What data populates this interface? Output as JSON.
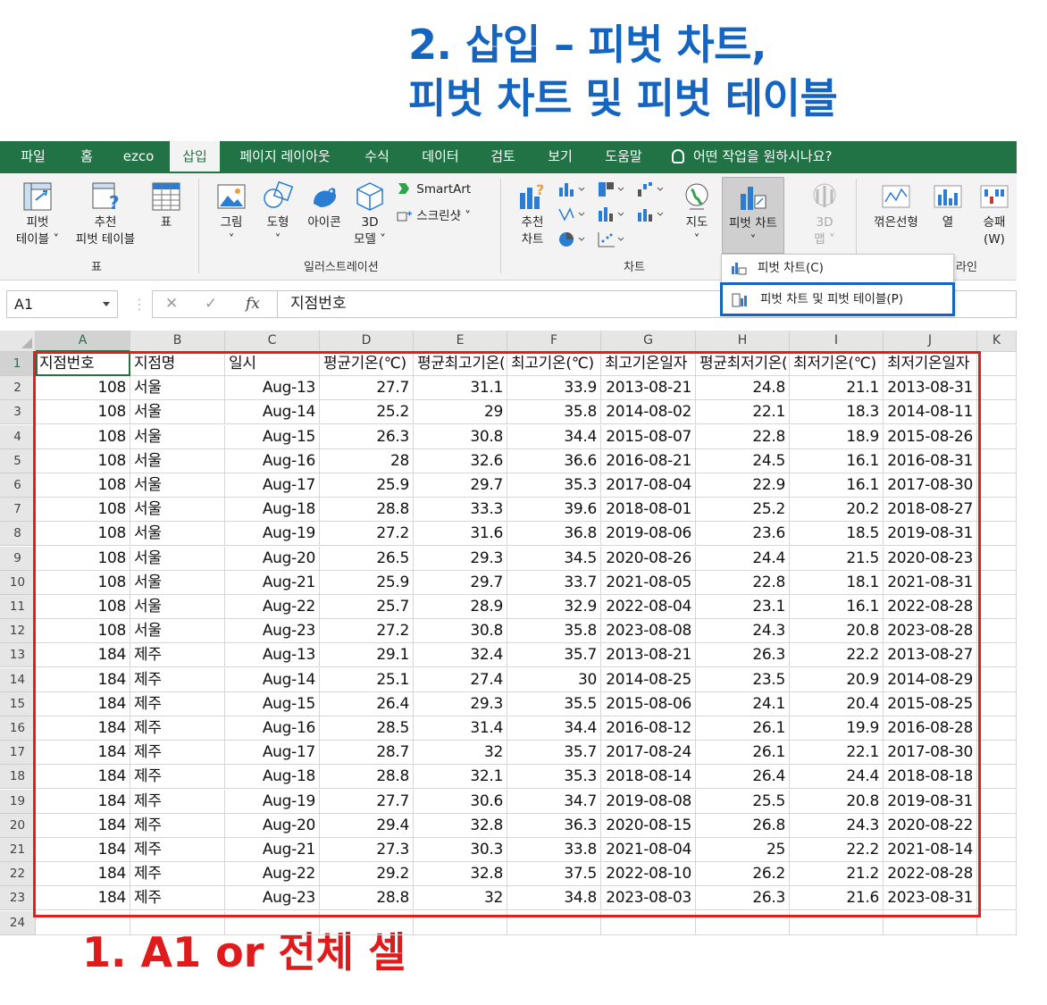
{
  "captions": {
    "top_line1": "2. 삽입 – 피벗 차트,",
    "top_line2": "피벗 차트 및 피벗 테이블",
    "bottom": "1. A1 or 전체 셀"
  },
  "colors": {
    "excel_green": "#217346",
    "caption_blue": "#1565c0",
    "caption_red": "#e01b1b"
  },
  "menu": {
    "tabs": [
      "파일",
      "홈",
      "ezco",
      "삽입",
      "페이지 레이아웃",
      "수식",
      "데이터",
      "검토",
      "보기",
      "도움말"
    ],
    "active_tab": "삽입",
    "tell_me": "어떤 작업을 원하시나요?"
  },
  "ribbon": {
    "pivot_table": [
      "피벗",
      "테이블 ˅"
    ],
    "recommended_pivot": [
      "추천",
      "피벗 테이블"
    ],
    "table": "표",
    "group_table": "표",
    "picture": "그림",
    "shapes": "도형",
    "icons": "아이콘",
    "model3d": [
      "3D",
      "모델 ˅"
    ],
    "smartart": "SmartArt",
    "screenshot": "스크린샷 ˅",
    "group_illustration": "일러스트레이션",
    "recommended_chart": [
      "추천",
      "차트"
    ],
    "maps": "지도",
    "pivot_chart": "피벗 차트",
    "map3d": [
      "3D",
      "맵 ˅"
    ],
    "group_chart": "차트",
    "line": "꺾은선형",
    "column": "열",
    "winloss": [
      "승패",
      "(W)"
    ],
    "group_sparkline_partial": "라인"
  },
  "dropdown": {
    "item1": "피벗 차트(C)",
    "item2": "피벗 차트 및 피벗 테이블(P)"
  },
  "formula_bar": {
    "name_box": "A1",
    "fx": "fx",
    "value": "지점번호"
  },
  "sheet": {
    "columns": [
      "A",
      "B",
      "C",
      "D",
      "E",
      "F",
      "G",
      "H",
      "I",
      "J",
      "K"
    ],
    "header": [
      "지점번호",
      "지점명",
      "일시",
      "평균기온(℃)",
      "평균최고기온(℃)",
      "최고기온(℃)",
      "최고기온일자",
      "평균최저기온(℃)",
      "최저기온(℃)",
      "최저기온일자"
    ],
    "rows": [
      [
        "108",
        "서울",
        "Aug-13",
        "27.7",
        "31.1",
        "33.9",
        "2013-08-21",
        "24.8",
        "21.1",
        "2013-08-31"
      ],
      [
        "108",
        "서울",
        "Aug-14",
        "25.2",
        "29",
        "35.8",
        "2014-08-02",
        "22.1",
        "18.3",
        "2014-08-11"
      ],
      [
        "108",
        "서울",
        "Aug-15",
        "26.3",
        "30.8",
        "34.4",
        "2015-08-07",
        "22.8",
        "18.9",
        "2015-08-26"
      ],
      [
        "108",
        "서울",
        "Aug-16",
        "28",
        "32.6",
        "36.6",
        "2016-08-21",
        "24.5",
        "16.1",
        "2016-08-31"
      ],
      [
        "108",
        "서울",
        "Aug-17",
        "25.9",
        "29.7",
        "35.3",
        "2017-08-04",
        "22.9",
        "16.1",
        "2017-08-30"
      ],
      [
        "108",
        "서울",
        "Aug-18",
        "28.8",
        "33.3",
        "39.6",
        "2018-08-01",
        "25.2",
        "20.2",
        "2018-08-27"
      ],
      [
        "108",
        "서울",
        "Aug-19",
        "27.2",
        "31.6",
        "36.8",
        "2019-08-06",
        "23.6",
        "18.5",
        "2019-08-31"
      ],
      [
        "108",
        "서울",
        "Aug-20",
        "26.5",
        "29.3",
        "34.5",
        "2020-08-26",
        "24.4",
        "21.5",
        "2020-08-23"
      ],
      [
        "108",
        "서울",
        "Aug-21",
        "25.9",
        "29.7",
        "33.7",
        "2021-08-05",
        "22.8",
        "18.1",
        "2021-08-31"
      ],
      [
        "108",
        "서울",
        "Aug-22",
        "25.7",
        "28.9",
        "32.9",
        "2022-08-04",
        "23.1",
        "16.1",
        "2022-08-28"
      ],
      [
        "108",
        "서울",
        "Aug-23",
        "27.2",
        "30.8",
        "35.8",
        "2023-08-08",
        "24.3",
        "20.8",
        "2023-08-28"
      ],
      [
        "184",
        "제주",
        "Aug-13",
        "29.1",
        "32.4",
        "35.7",
        "2013-08-21",
        "26.3",
        "22.2",
        "2013-08-27"
      ],
      [
        "184",
        "제주",
        "Aug-14",
        "25.1",
        "27.4",
        "30",
        "2014-08-25",
        "23.5",
        "20.9",
        "2014-08-29"
      ],
      [
        "184",
        "제주",
        "Aug-15",
        "26.4",
        "29.3",
        "35.5",
        "2015-08-06",
        "24.1",
        "20.4",
        "2015-08-25"
      ],
      [
        "184",
        "제주",
        "Aug-16",
        "28.5",
        "31.4",
        "34.4",
        "2016-08-12",
        "26.1",
        "19.9",
        "2016-08-28"
      ],
      [
        "184",
        "제주",
        "Aug-17",
        "28.7",
        "32",
        "35.7",
        "2017-08-24",
        "26.1",
        "22.1",
        "2017-08-30"
      ],
      [
        "184",
        "제주",
        "Aug-18",
        "28.8",
        "32.1",
        "35.3",
        "2018-08-14",
        "26.4",
        "24.4",
        "2018-08-18"
      ],
      [
        "184",
        "제주",
        "Aug-19",
        "27.7",
        "30.6",
        "34.7",
        "2019-08-08",
        "25.5",
        "20.8",
        "2019-08-31"
      ],
      [
        "184",
        "제주",
        "Aug-20",
        "29.4",
        "32.8",
        "36.3",
        "2020-08-15",
        "26.8",
        "24.3",
        "2020-08-22"
      ],
      [
        "184",
        "제주",
        "Aug-21",
        "27.3",
        "30.3",
        "33.8",
        "2021-08-04",
        "25",
        "22.2",
        "2021-08-14"
      ],
      [
        "184",
        "제주",
        "Aug-22",
        "29.2",
        "32.8",
        "37.5",
        "2022-08-10",
        "26.2",
        "21.2",
        "2022-08-28"
      ],
      [
        "184",
        "제주",
        "Aug-23",
        "28.8",
        "32",
        "34.8",
        "2023-08-03",
        "26.3",
        "21.6",
        "2023-08-31"
      ]
    ],
    "row_numbers": [
      "1",
      "2",
      "3",
      "4",
      "5",
      "6",
      "7",
      "8",
      "9",
      "10",
      "11",
      "12",
      "13",
      "14",
      "15",
      "16",
      "17",
      "18",
      "19",
      "20",
      "21",
      "22",
      "23",
      "24"
    ],
    "text_columns": [
      1
    ]
  }
}
